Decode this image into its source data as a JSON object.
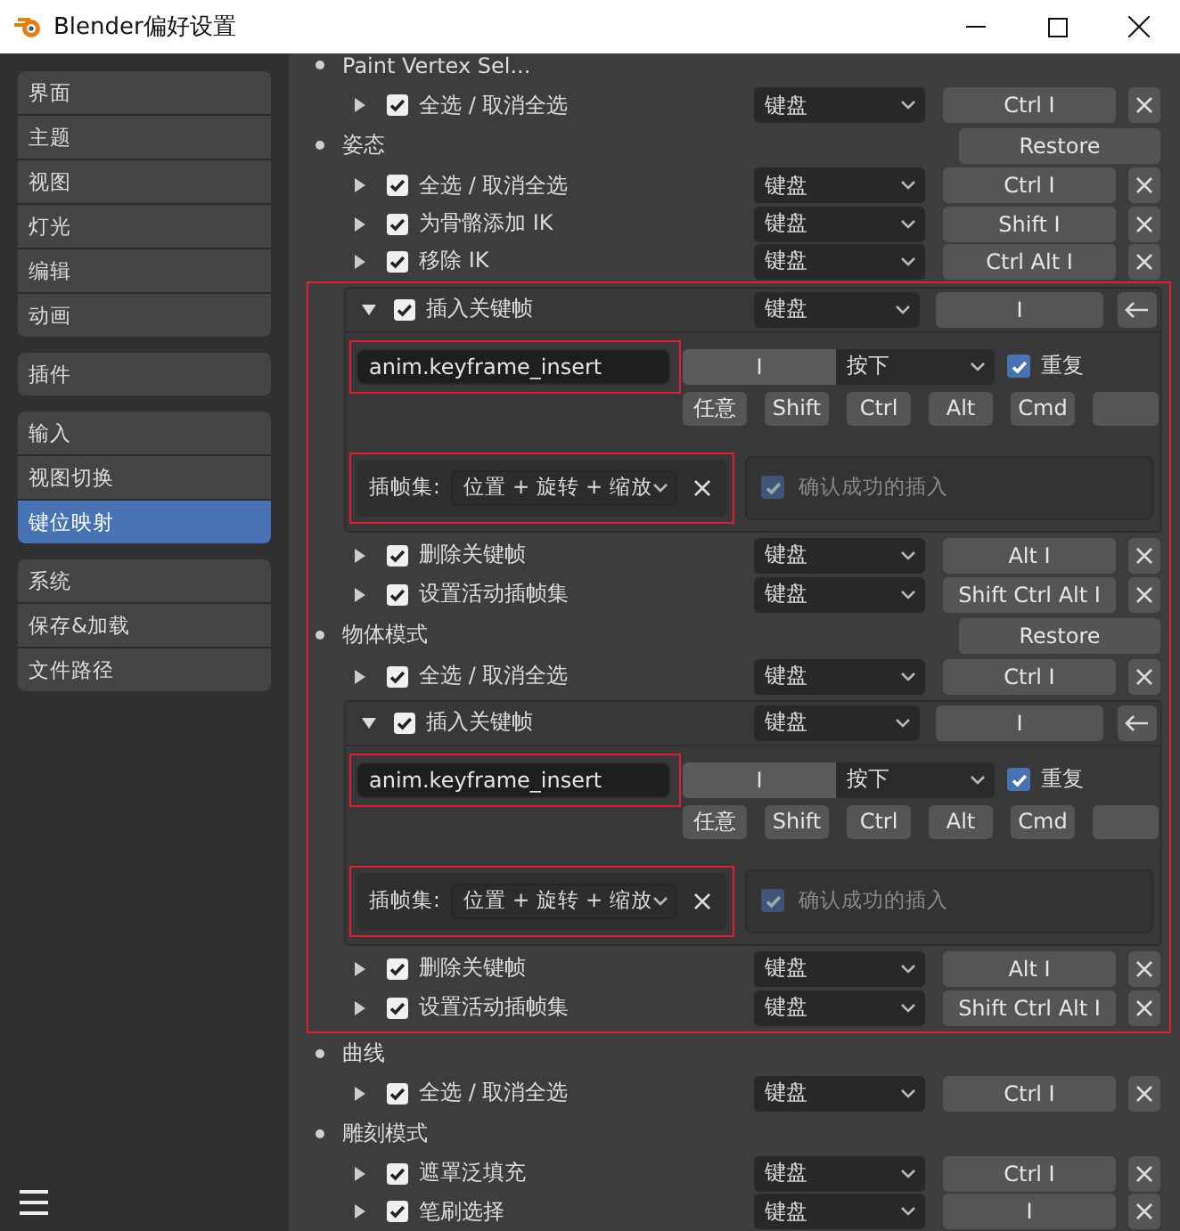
{
  "window": {
    "title": "Blender偏好设置"
  },
  "sidebar": {
    "groups": [
      {
        "items": [
          {
            "label": "界面",
            "selected": false
          },
          {
            "label": "主题",
            "selected": false
          },
          {
            "label": "视图",
            "selected": false
          },
          {
            "label": "灯光",
            "selected": false
          },
          {
            "label": "编辑",
            "selected": false
          },
          {
            "label": "动画",
            "selected": false
          }
        ]
      },
      {
        "items": [
          {
            "label": "插件",
            "selected": false
          }
        ]
      },
      {
        "items": [
          {
            "label": "输入",
            "selected": false
          },
          {
            "label": "视图切换",
            "selected": false
          },
          {
            "label": "键位映射",
            "selected": true
          }
        ]
      },
      {
        "items": [
          {
            "label": "系统",
            "selected": false
          },
          {
            "label": "保存&加载",
            "selected": false
          },
          {
            "label": "文件路径",
            "selected": false
          }
        ]
      }
    ]
  },
  "keymap": [
    {
      "kind": "category",
      "label": "Paint Vertex Sel..."
    },
    {
      "kind": "item",
      "expanded": false,
      "checked": true,
      "label": "全选 / 取消全选",
      "input": "键盘",
      "key": "Ctrl I"
    },
    {
      "kind": "category",
      "label": "姿态",
      "restore": "Restore"
    },
    {
      "kind": "item",
      "expanded": false,
      "checked": true,
      "label": "全选 / 取消全选",
      "input": "键盘",
      "key": "Ctrl I"
    },
    {
      "kind": "item",
      "expanded": false,
      "checked": true,
      "label": "为骨骼添加 IK",
      "input": "键盘",
      "key": "Shift I"
    },
    {
      "kind": "item",
      "expanded": false,
      "checked": true,
      "label": "移除 IK",
      "input": "键盘",
      "key": "Ctrl Alt I"
    },
    {
      "kind": "marked_group",
      "children": [
        {
          "kind": "item",
          "expanded": true,
          "checked": true,
          "label": "插入关键帧",
          "input": "键盘",
          "key": "I",
          "details": {
            "operator": "anim.keyframe_insert",
            "operator_marked": true,
            "key": "I",
            "event": "按下",
            "repeat": {
              "label": "重复",
              "checked": true
            },
            "modifiers": [
              {
                "label": "任意"
              },
              {
                "label": "Shift"
              },
              {
                "label": "Ctrl"
              },
              {
                "label": "Alt"
              },
              {
                "label": "Cmd"
              }
            ],
            "keying_set": {
              "label": "插帧集:",
              "value": "位置 + 旋转 + 缩放",
              "marked": true
            },
            "confirm": {
              "label": "确认成功的插入",
              "checked": true,
              "disabled": true
            }
          }
        },
        {
          "kind": "item",
          "expanded": false,
          "checked": true,
          "label": "删除关键帧",
          "input": "键盘",
          "key": "Alt I"
        },
        {
          "kind": "item",
          "expanded": false,
          "checked": true,
          "label": "设置活动插帧集",
          "input": "键盘",
          "key": "Shift Ctrl Alt I"
        },
        {
          "kind": "category",
          "label": "物体模式",
          "restore": "Restore"
        },
        {
          "kind": "item",
          "expanded": false,
          "checked": true,
          "label": "全选 / 取消全选",
          "input": "键盘",
          "key": "Ctrl I"
        },
        {
          "kind": "item",
          "expanded": true,
          "checked": true,
          "label": "插入关键帧",
          "input": "键盘",
          "key": "I",
          "details": {
            "operator": "anim.keyframe_insert",
            "operator_marked": true,
            "key": "I",
            "event": "按下",
            "repeat": {
              "label": "重复",
              "checked": true
            },
            "modifiers": [
              {
                "label": "任意"
              },
              {
                "label": "Shift"
              },
              {
                "label": "Ctrl"
              },
              {
                "label": "Alt"
              },
              {
                "label": "Cmd"
              }
            ],
            "keying_set": {
              "label": "插帧集:",
              "value": "位置 + 旋转 + 缩放",
              "marked": true
            },
            "confirm": {
              "label": "确认成功的插入",
              "checked": true,
              "disabled": true
            }
          }
        },
        {
          "kind": "item",
          "expanded": false,
          "checked": true,
          "label": "删除关键帧",
          "input": "键盘",
          "key": "Alt I"
        },
        {
          "kind": "item",
          "expanded": false,
          "checked": true,
          "label": "设置活动插帧集",
          "input": "键盘",
          "key": "Shift Ctrl Alt I"
        }
      ]
    },
    {
      "kind": "category",
      "label": "曲线"
    },
    {
      "kind": "item",
      "expanded": false,
      "checked": true,
      "label": "全选 / 取消全选",
      "input": "键盘",
      "key": "Ctrl I"
    },
    {
      "kind": "category",
      "label": "雕刻模式"
    },
    {
      "kind": "item",
      "expanded": false,
      "checked": true,
      "label": "遮罩泛填充",
      "input": "键盘",
      "key": "Ctrl I"
    },
    {
      "kind": "item",
      "expanded": false,
      "checked": true,
      "label": "笔刷选择",
      "input": "键盘",
      "key": "I"
    }
  ]
}
